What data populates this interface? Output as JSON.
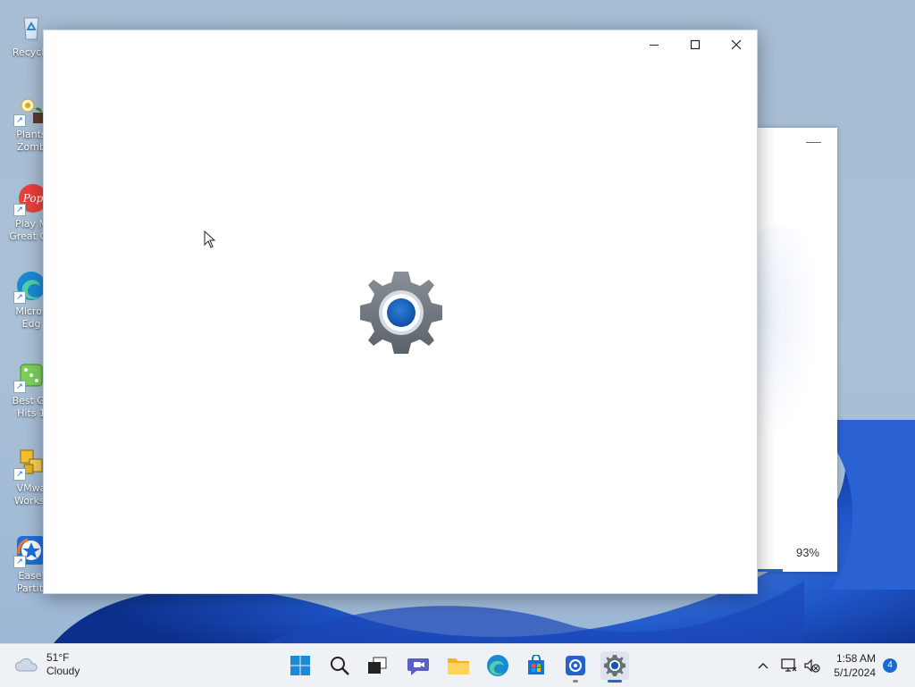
{
  "desktop": {
    "icons": [
      {
        "label": "Recycle",
        "icon": "recycle-bin-icon"
      },
      {
        "label": "Plants",
        "label2": "Zomb",
        "icon": "plants-vs-zombies-icon"
      },
      {
        "label": "Play M",
        "label2": "Great Ga",
        "icon": "popcap-icon"
      },
      {
        "label": "Micros",
        "label2": "Edg",
        "icon": "edge-icon"
      },
      {
        "label": "Best Ga",
        "label2": "Hits 1",
        "icon": "dice-icon"
      },
      {
        "label": "VMwa",
        "label2": "Workst",
        "icon": "vmware-icon"
      },
      {
        "label": "Easel",
        "label2": "Partiti",
        "icon": "easeus-icon"
      }
    ]
  },
  "settings_window": {
    "app": "Settings",
    "splash_icon": "settings-gear-icon",
    "controls": {
      "minimize": "minimize-icon",
      "maximize": "maximize-icon",
      "close": "close-icon"
    }
  },
  "background_window": {
    "progress_text": "93%",
    "progress": 0.93
  },
  "taskbar": {
    "weather": {
      "temp": "51°F",
      "condition": "Cloudy",
      "icon": "cloud-icon"
    },
    "apps": [
      {
        "name": "start-button",
        "icon": "windows-logo-icon"
      },
      {
        "name": "search-button",
        "icon": "search-icon"
      },
      {
        "name": "task-view-button",
        "icon": "task-view-icon"
      },
      {
        "name": "chat-button",
        "icon": "teams-chat-icon"
      },
      {
        "name": "file-explorer-button",
        "icon": "folder-icon"
      },
      {
        "name": "edge-button",
        "icon": "edge-icon"
      },
      {
        "name": "store-button",
        "icon": "store-icon"
      },
      {
        "name": "app-button",
        "icon": "app-icon"
      },
      {
        "name": "settings-button",
        "icon": "gear-icon",
        "active": true
      }
    ],
    "tray": {
      "chevron": "chevron-up-icon",
      "network": "network-icon",
      "volume": "volume-muted-icon"
    },
    "clock": {
      "time": "1:58 AM",
      "date": "5/1/2024"
    },
    "notifications_count": "4"
  },
  "colors": {
    "accent": "#1a6ad0",
    "taskbar": "#eef2f7",
    "wallpaper": "#a7bdd4"
  }
}
